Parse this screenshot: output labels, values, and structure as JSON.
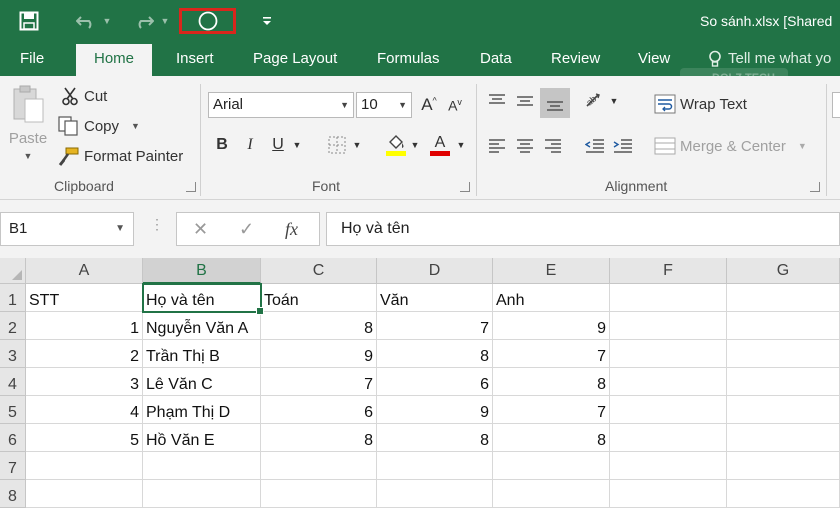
{
  "window": {
    "title": "So sánh.xlsx  [Shared",
    "brand_color": "#217346"
  },
  "quick_access": {
    "save_icon": "save-icon",
    "undo_icon": "undo-icon",
    "redo_icon": "redo-icon",
    "circle_icon": "circle-shape-icon",
    "customize_icon": "customize-toolbar-icon",
    "highlight_color": "#d9261c"
  },
  "tabs": [
    {
      "label": "File"
    },
    {
      "label": "Home"
    },
    {
      "label": "Insert"
    },
    {
      "label": "Page Layout"
    },
    {
      "label": "Formulas"
    },
    {
      "label": "Data"
    },
    {
      "label": "Review"
    },
    {
      "label": "View"
    }
  ],
  "tell_me": "Tell me what yo",
  "watermark": "DOLZ TECH",
  "clipboard": {
    "paste": "Paste",
    "cut": "Cut",
    "copy": "Copy",
    "format_painter": "Format Painter",
    "group_label": "Clipboard"
  },
  "font": {
    "name": "Arial",
    "size": "10",
    "bold": "B",
    "italic": "I",
    "underline": "U",
    "font_color_letter": "A",
    "fill_color": "#ffff00",
    "text_color": "#e00000",
    "group_label": "Font"
  },
  "alignment": {
    "wrap_text": "Wrap Text",
    "merge_center": "Merge & Center",
    "group_label": "Alignment"
  },
  "formula_bar": {
    "name_box": "B1",
    "fx": "fx",
    "formula": "Họ và tên"
  },
  "sheet": {
    "columns": [
      "A",
      "B",
      "C",
      "D",
      "E",
      "F",
      "G"
    ],
    "rows": [
      "1",
      "2",
      "3",
      "4",
      "5",
      "6",
      "7",
      "8"
    ],
    "cells": [
      [
        "STT",
        "Họ và tên",
        "Toán",
        "Văn",
        "Anh",
        "",
        ""
      ],
      [
        "1",
        "Nguyễn Văn A",
        "8",
        "7",
        "9",
        "",
        ""
      ],
      [
        "2",
        "Trần Thị B",
        "9",
        "8",
        "7",
        "",
        ""
      ],
      [
        "3",
        "Lê Văn C",
        "7",
        "6",
        "8",
        "",
        ""
      ],
      [
        "4",
        "Phạm Thị D",
        "6",
        "9",
        "7",
        "",
        ""
      ],
      [
        "5",
        "Hồ Văn E",
        "8",
        "8",
        "8",
        "",
        ""
      ],
      [
        "",
        "",
        "",
        "",
        "",
        "",
        ""
      ],
      [
        "",
        "",
        "",
        "",
        "",
        "",
        ""
      ]
    ],
    "selected_cell": "B1"
  }
}
